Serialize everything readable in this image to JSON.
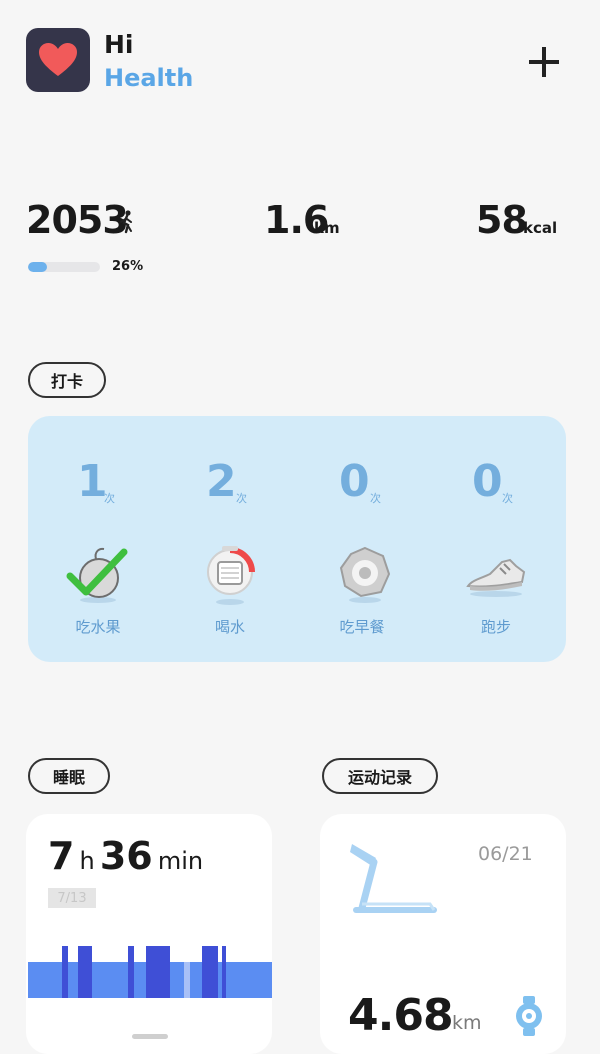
{
  "header": {
    "greeting_line1": "Hi",
    "greeting_line2": "Health",
    "app_icon": "heart-icon",
    "add_icon": "plus-icon"
  },
  "stats": {
    "steps": "2053",
    "steps_icon": "walking-icon",
    "distance": "1.6",
    "distance_unit": "km",
    "calories": "58",
    "calories_unit": "kcal",
    "progress_percent": 26,
    "progress_text": "26%"
  },
  "checkin": {
    "title": "打卡",
    "items": [
      {
        "count": "1",
        "unit": "次",
        "label": "吃水果",
        "icon": "fruit-check-icon"
      },
      {
        "count": "2",
        "unit": "次",
        "label": "喝水",
        "icon": "water-cup-icon"
      },
      {
        "count": "0",
        "unit": "次",
        "label": "吃早餐",
        "icon": "fried-egg-icon"
      },
      {
        "count": "0",
        "unit": "次",
        "label": "跑步",
        "icon": "sneaker-icon"
      }
    ]
  },
  "sleep": {
    "title": "睡眠",
    "hours": "7",
    "hours_unit": "h",
    "minutes": "36",
    "minutes_unit": "min",
    "date": "7/13"
  },
  "exercise": {
    "title": "运动记录",
    "date": "06/21",
    "distance": "4.68",
    "distance_unit": "km",
    "equipment_icon": "treadmill-icon",
    "device_icon": "watch-icon"
  },
  "colors": {
    "accent_blue": "#5aa6e6",
    "checkin_bg": "#d3ebf9",
    "checkin_text": "#74aedd",
    "sleep_light": "#5b8df2",
    "sleep_deep": "#3f4fd6",
    "heart_red": "#f15a5a"
  }
}
